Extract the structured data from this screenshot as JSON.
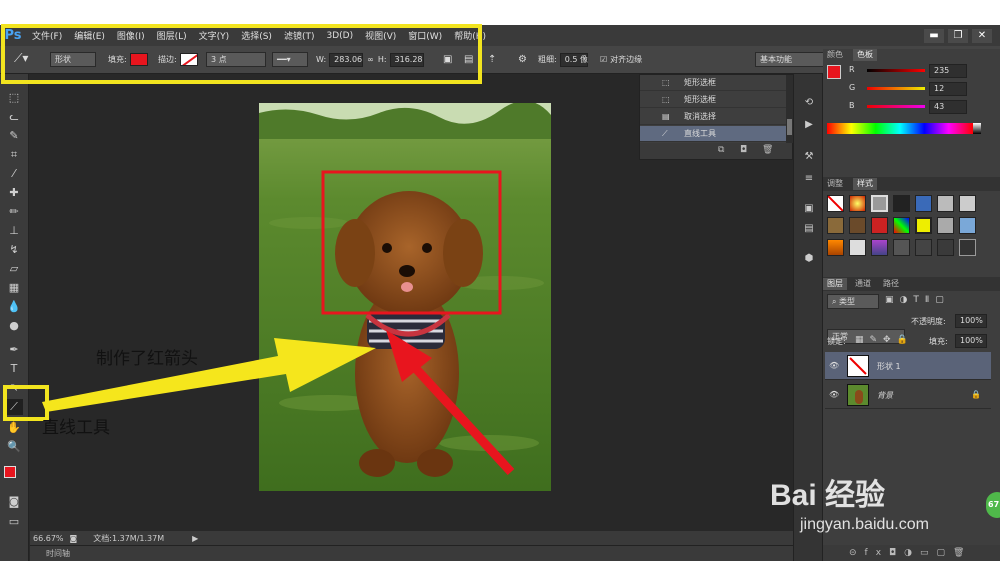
{
  "app": {
    "logo": "Ps"
  },
  "menu": {
    "items": [
      "文件(F)",
      "编辑(E)",
      "图像(I)",
      "图层(L)",
      "文字(Y)",
      "选择(S)",
      "滤镜(T)",
      "3D(D)",
      "视图(V)",
      "窗口(W)",
      "帮助(H)"
    ]
  },
  "window_controls": [
    "▬",
    "❐",
    "✕"
  ],
  "options": {
    "mode": "形状",
    "fill_label": "填充:",
    "stroke_label": "描边:",
    "stroke_size": "3 点",
    "w_label": "W:",
    "w_value": "283.06",
    "h_label": "H:",
    "h_value": "316.28",
    "weight_label": "粗细:",
    "weight_value": "0.5 像",
    "align_edges": "对齐边缘",
    "workspace": "基本功能",
    "fill_color": "#e8151e"
  },
  "history": {
    "items": [
      "矩形选框",
      "矩形选框",
      "取消选择",
      "直线工具"
    ]
  },
  "color_panel": {
    "tabs": [
      "颜色",
      "色板"
    ],
    "channels": [
      {
        "label": "R",
        "value": "235"
      },
      {
        "label": "G",
        "value": "12"
      },
      {
        "label": "B",
        "value": "43"
      }
    ]
  },
  "styles_panel": {
    "tabs": [
      "调整",
      "样式"
    ]
  },
  "layers_panel": {
    "tabs": [
      "图层",
      "通道",
      "路径"
    ],
    "kind": "类型",
    "blend": "正常",
    "opacity_label": "不透明度:",
    "opacity": "100%",
    "lock_label": "锁定:",
    "fill_label": "填充:",
    "fill": "100%",
    "layers": [
      {
        "name": "形状 1"
      },
      {
        "name": "背景"
      }
    ]
  },
  "status": {
    "zoom": "66.67%",
    "doc": "文档:1.37M/1.37M"
  },
  "timeline": {
    "label": "时间轴"
  },
  "annotations": {
    "arrow_text": "制作了红箭头",
    "tool_text": "直线工具"
  },
  "watermark": {
    "main": "Bai 经验",
    "url": "jingyan.baidu.com"
  },
  "badge": {
    "value": "67"
  }
}
